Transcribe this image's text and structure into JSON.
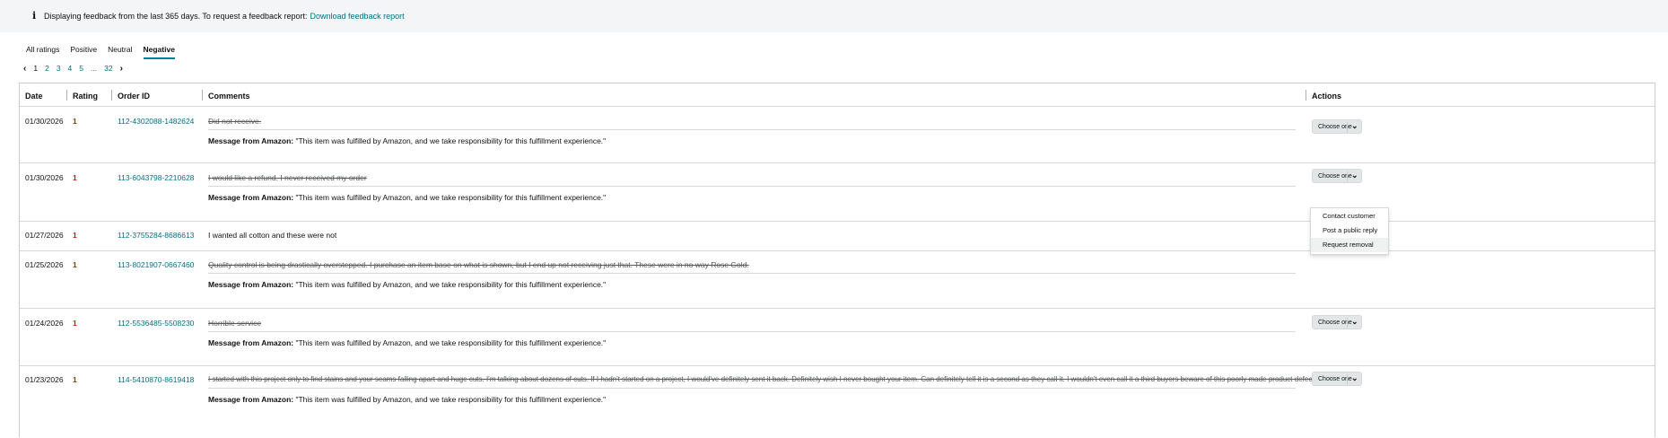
{
  "banner": {
    "icon": "info-icon",
    "text": "Displaying feedback from the last 365 days. To request a feedback report:",
    "link": "Download feedback report"
  },
  "tabs": [
    {
      "label": "All ratings",
      "active": false
    },
    {
      "label": "Positive",
      "active": false
    },
    {
      "label": "Neutral",
      "active": false
    },
    {
      "label": "Negative",
      "active": true
    }
  ],
  "pagination": {
    "pages": [
      "1",
      "2",
      "3",
      "4",
      "5"
    ],
    "ellipsis": "...",
    "last": "32",
    "current": "1"
  },
  "table": {
    "headers": {
      "date": "Date",
      "rating": "Rating",
      "order_id": "Order ID",
      "comments": "Comments",
      "actions": "Actions"
    },
    "message_label": "Message from Amazon:",
    "select_placeholder": "Choose one",
    "rows": [
      {
        "date": "01/30/2026",
        "rating": "1",
        "order_id": "112-4302088-1482624",
        "comment": "Did not receive.",
        "message": "\"This item was fulfilled by Amazon, and we take responsibility for this fulfillment experience.\""
      },
      {
        "date": "01/30/2026",
        "rating": "1",
        "order_id": "113-6043798-2210628",
        "comment": "I would like a refund. I never received my order",
        "message": "\"This item was fulfilled by Amazon, and we take responsibility for this fulfillment experience.\""
      },
      {
        "date": "01/27/2026",
        "rating": "1",
        "order_id": "112-3755284-8686613",
        "comment": "I wanted all cotton and these were not",
        "message": ""
      },
      {
        "date": "01/25/2026",
        "rating": "1",
        "order_id": "113-8021907-0667460",
        "comment": "Quality control is being drastically overstepped. I purchase an item base on what is shown, but I end up not receiving just that. These were in no way Rose Gold.",
        "message": "\"This item was fulfilled by Amazon, and we take responsibility for this fulfillment experience.\""
      },
      {
        "date": "01/24/2026",
        "rating": "1",
        "order_id": "112-5536485-5508230",
        "comment": "Horrible service",
        "message": "\"This item was fulfilled by Amazon, and we take responsibility for this fulfillment experience.\""
      },
      {
        "date": "01/23/2026",
        "rating": "1",
        "order_id": "114-5410870-8619418",
        "comment": "I started with this project only to find stains and your seams falling apart and huge cuts. I'm talking about dozens of cuts. If I hadn't started on a project, I would've definitely sent it back. Definitely wish I never bought your item. Can definitely tell it is a second as they call it. I wouldn't even call it a third buyers beware of this poorly made product defective.",
        "message": "\"This item was fulfilled by Amazon, and we take responsibility for this fulfillment experience.\""
      }
    ]
  },
  "dropdown_menu": {
    "items": [
      "Contact customer",
      "Post a public reply",
      "Request removal"
    ],
    "highlighted": "Request removal"
  },
  "colors": {
    "link": "#007185",
    "rating": "#b12704",
    "tab_underline": "#008296",
    "banner_bg": "#f3f5f6"
  }
}
